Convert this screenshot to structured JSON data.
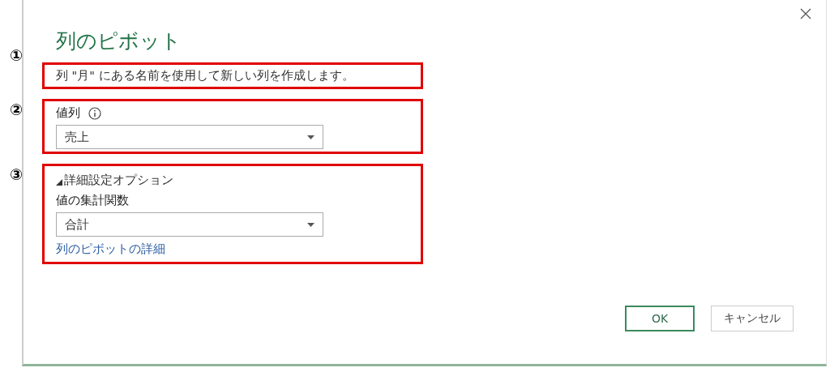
{
  "dialog": {
    "title": "列のピボット"
  },
  "sections": [
    {
      "marker": "①",
      "kind": "description",
      "text": "列 \"月\" にある名前を使用して新しい列を作成します。"
    },
    {
      "marker": "②",
      "kind": "value_column",
      "label": "値列",
      "value": "売上"
    },
    {
      "marker": "③",
      "kind": "advanced",
      "toggle": "詳細設定オプション",
      "expanded": true,
      "label": "値の集計関数",
      "value": "合計",
      "link": "列のピボットの詳細"
    }
  ],
  "buttons": [
    {
      "label": "OK",
      "primary": true
    },
    {
      "label": "キャンセル",
      "primary": false
    }
  ]
}
